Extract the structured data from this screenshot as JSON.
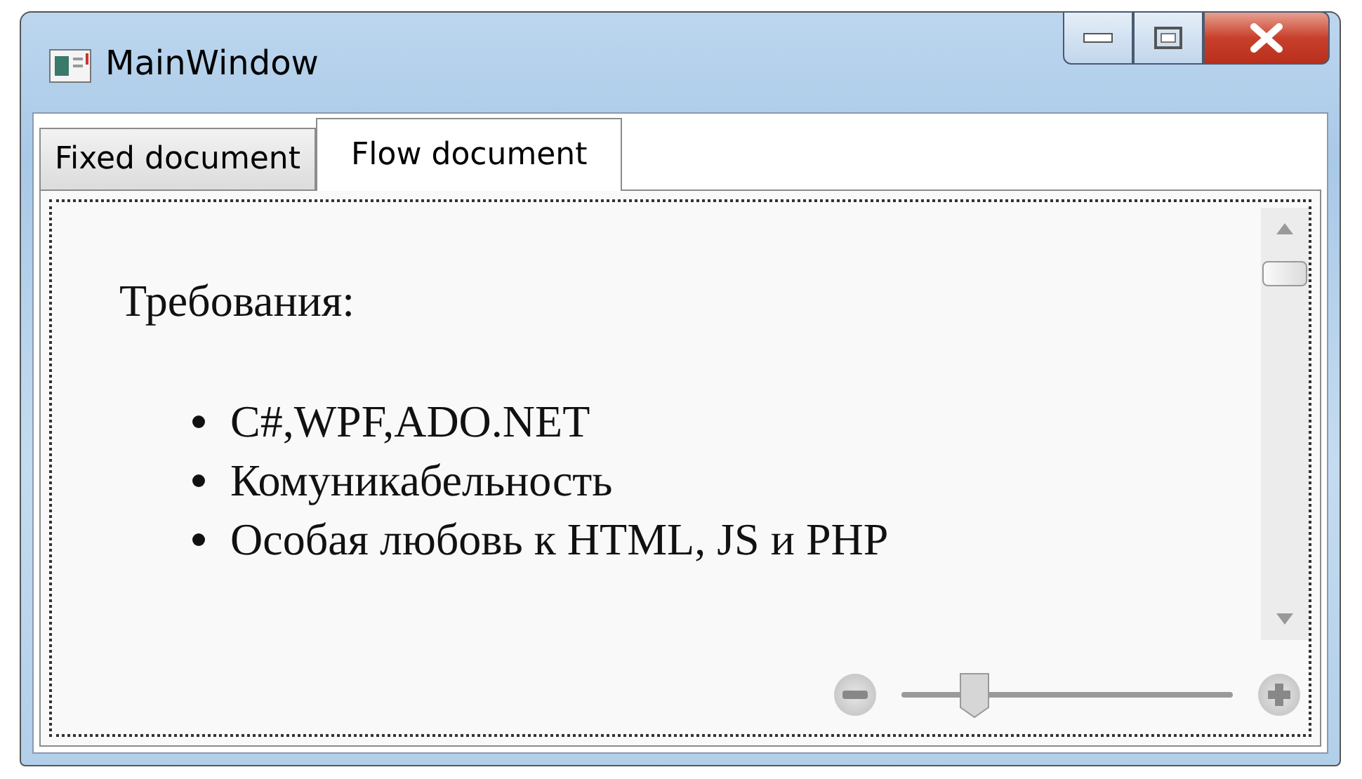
{
  "window": {
    "title": "MainWindow"
  },
  "tabs": [
    {
      "label": "Fixed document",
      "selected": false
    },
    {
      "label": "Flow document",
      "selected": true
    }
  ],
  "document": {
    "heading": "Требования:",
    "items": [
      "C#,WPF,ADO.NET",
      "Комуникабельность",
      "Особая любовь к HTML, JS и PHP"
    ]
  },
  "zoom_slider": {
    "level": 0.22
  }
}
